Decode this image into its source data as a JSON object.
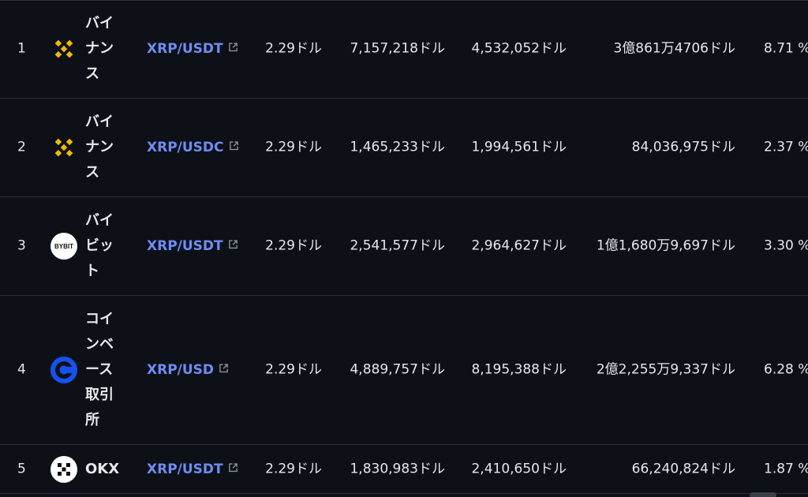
{
  "rows": [
    {
      "rank": "1",
      "exchange": "バイナンス",
      "logo_icon": "binance-logo",
      "pair": "XRP/USDT",
      "price": "2.29ドル",
      "volume_a": "7,157,218ドル",
      "volume_b": "4,532,052ドル",
      "volume_c": "3億861万4706ドル",
      "share": "8.71 %"
    },
    {
      "rank": "2",
      "exchange": "バイナンス",
      "logo_icon": "binance-logo",
      "pair": "XRP/USDC",
      "price": "2.29ドル",
      "volume_a": "1,465,233ドル",
      "volume_b": "1,994,561ドル",
      "volume_c": "84,036,975ドル",
      "share": "2.37 %"
    },
    {
      "rank": "3",
      "exchange": "バイビット",
      "logo_icon": "bybit-logo",
      "logo_text": "BYBIT",
      "pair": "XRP/USDT",
      "price": "2.29ドル",
      "volume_a": "2,541,577ドル",
      "volume_b": "2,964,627ドル",
      "volume_c": "1億1,680万9,697ドル",
      "share": "3.30 %"
    },
    {
      "rank": "4",
      "exchange": "コインベース取引所",
      "logo_icon": "coinbase-logo",
      "pair": "XRP/USD",
      "price": "2.29ドル",
      "volume_a": "4,889,757ドル",
      "volume_b": "8,195,388ドル",
      "volume_c": "2億2,255万9,337ドル",
      "share": "6.28 %"
    },
    {
      "rank": "5",
      "exchange": "OKX",
      "logo_icon": "okx-logo",
      "pair": "XRP/USDT",
      "price": "2.29ドル",
      "volume_a": "1,830,983ドル",
      "volume_b": "2,410,650ドル",
      "volume_c": "66,240,824ドル",
      "share": "1.87 %"
    }
  ],
  "colors": {
    "background": "#0d1117",
    "link": "#6f8cf5",
    "binance": "#f0b90b",
    "coinbase": "#1652f0",
    "divider": "#2b3139"
  }
}
